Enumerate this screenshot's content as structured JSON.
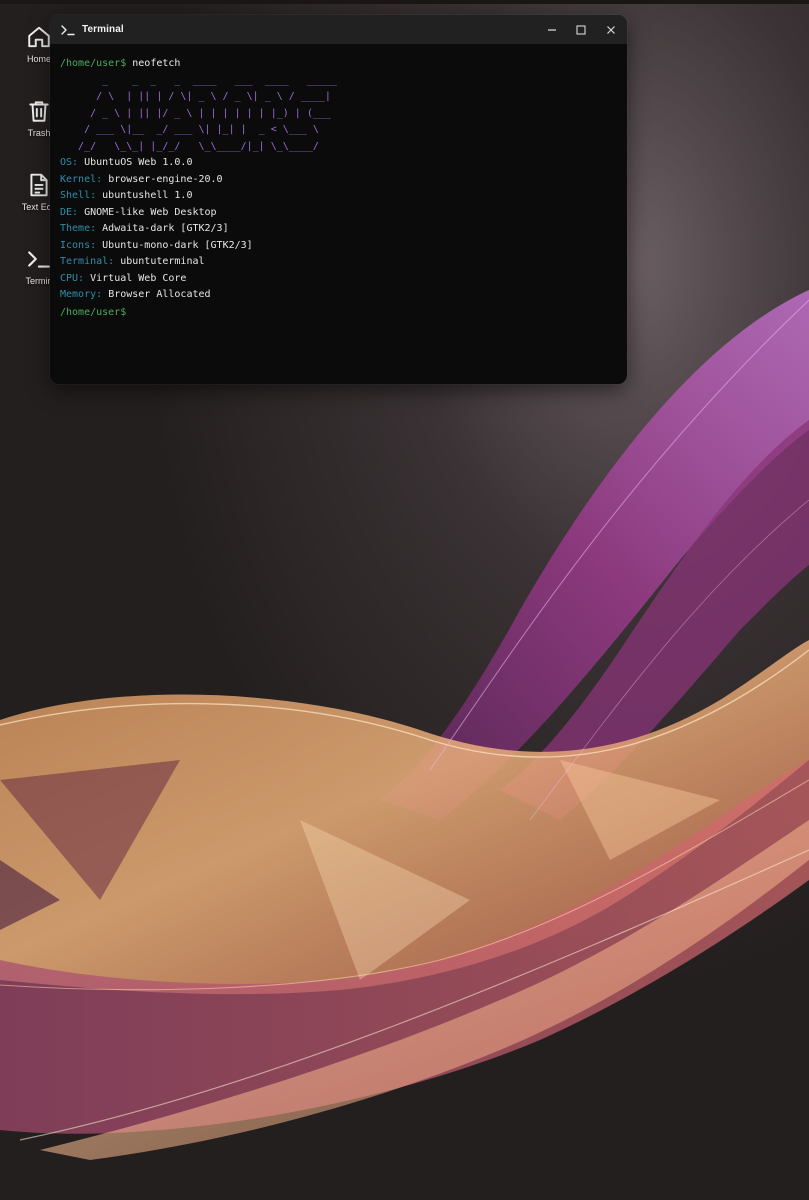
{
  "desktop": {
    "icons": [
      {
        "label": "Home",
        "icon": "home-icon"
      },
      {
        "label": "Trash",
        "icon": "trash-icon"
      },
      {
        "label": "Text Edit",
        "icon": "text-editor-icon"
      },
      {
        "label": "Termin",
        "icon": "terminal-icon"
      }
    ]
  },
  "terminal": {
    "title": "Terminal",
    "title_icon": "terminal-prompt-icon",
    "controls": [
      "minimize-icon",
      "maximize-icon",
      "close-icon"
    ],
    "prompt": "/home/user$",
    "command": "neofetch",
    "ascii_art": [
      "       _    _  _   _  ____   ___  ____   _____",
      "      / \\  | || | / \\| _ \\ / _ \\| _ \\ / ____|",
      "     / _ \\ | || |/ _ \\ | | | | | | |_) | (___",
      "    / ___ \\|__  _/ ___ \\| |_| |  _ < \\___ \\",
      "   /_/   \\_\\_| |_/_/   \\_\\____/|_| \\_\\____/"
    ],
    "info": [
      {
        "key": "OS:",
        "value": "UbuntuOS Web 1.0.0"
      },
      {
        "key": "Kernel:",
        "value": "browser-engine-20.0"
      },
      {
        "key": "Shell:",
        "value": "ubuntushell 1.0"
      },
      {
        "key": "DE:",
        "value": "GNOME-like Web Desktop"
      },
      {
        "key": "Theme:",
        "value": "Adwaita-dark [GTK2/3]"
      },
      {
        "key": "Icons:",
        "value": "Ubuntu-mono-dark [GTK2/3]"
      },
      {
        "key": "Terminal:",
        "value": "ubuntuterminal"
      },
      {
        "key": "CPU:",
        "value": "Virtual Web Core"
      },
      {
        "key": "Memory:",
        "value": "Browser Allocated"
      }
    ],
    "final_prompt": "/home/user$"
  },
  "colors": {
    "prompt": "#4cab5c",
    "ascii": "#9b6ed7",
    "info_key": "#2f8eac",
    "terminal_bg": "#0b0b0c",
    "titlebar_bg": "#222122"
  }
}
